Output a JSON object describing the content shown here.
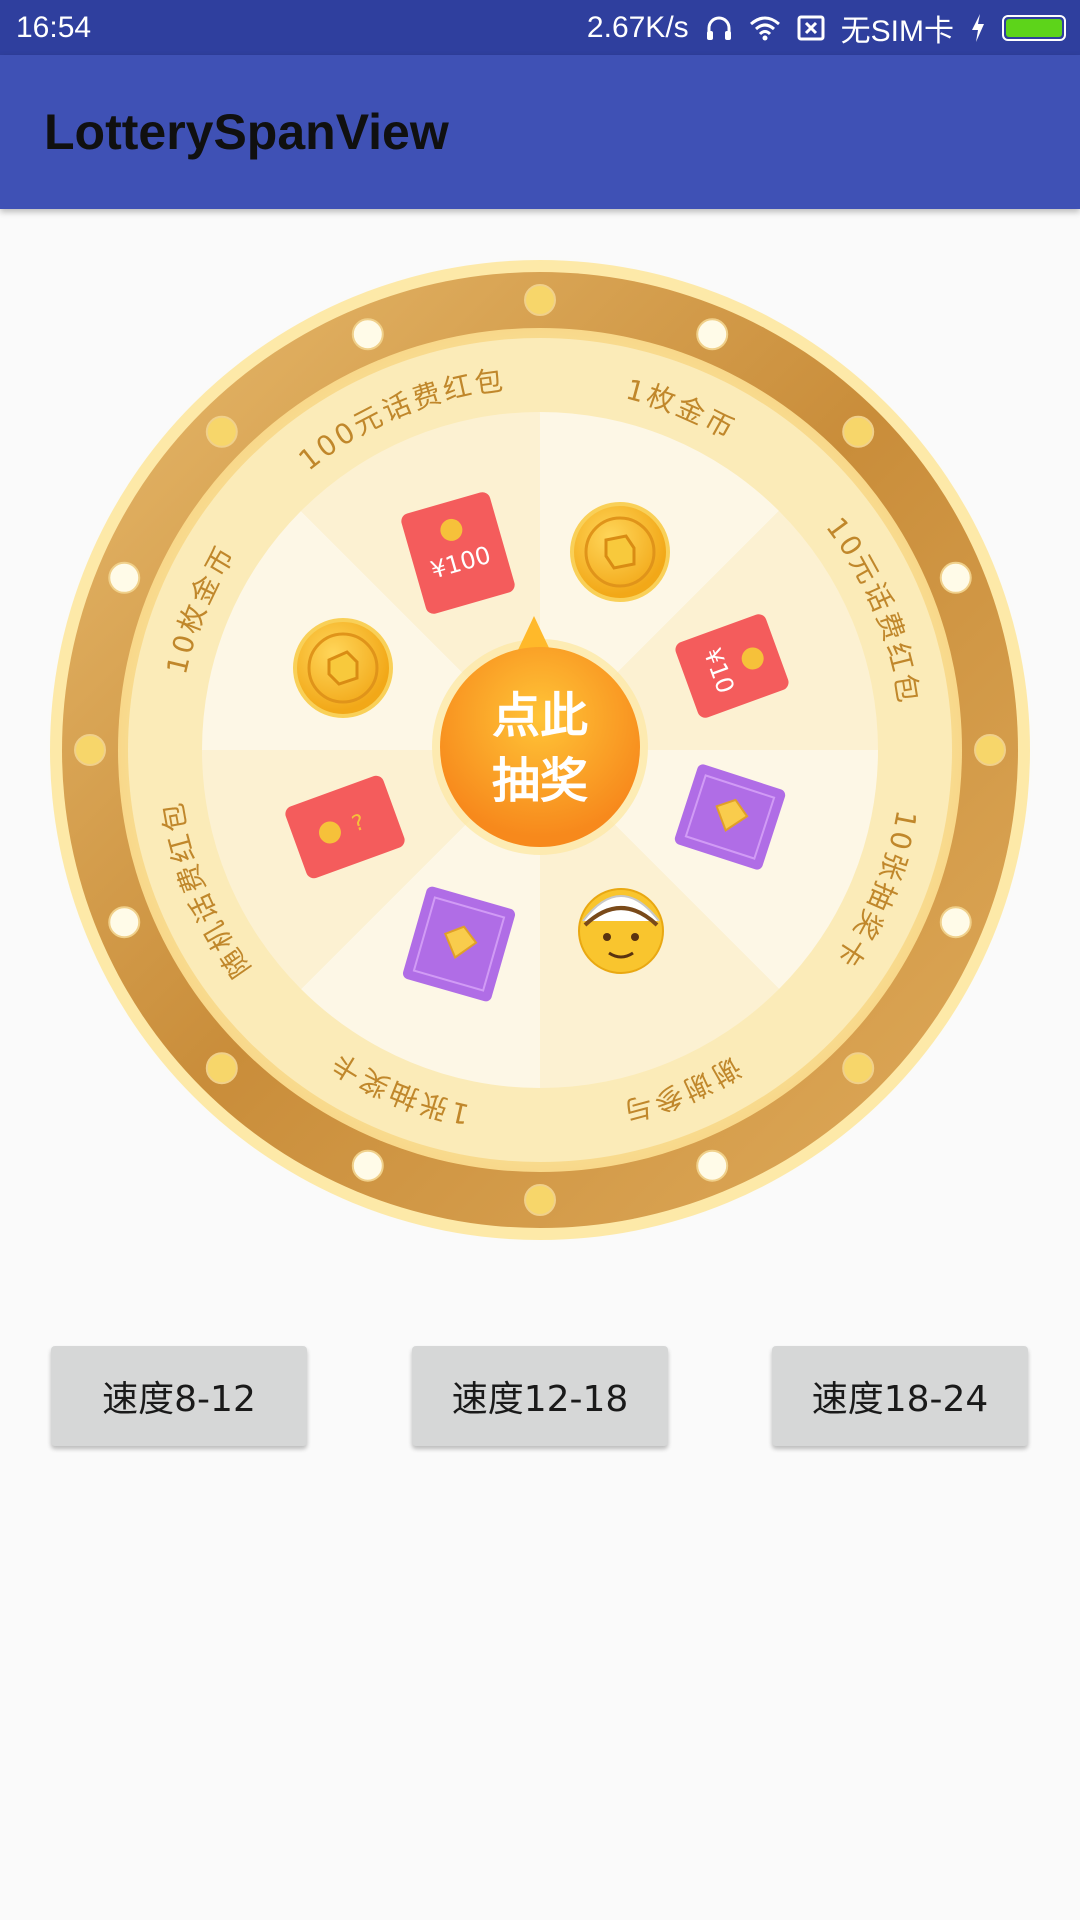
{
  "status_bar": {
    "time": "16:54",
    "speed": "2.67K/s",
    "sim": "无SIM卡",
    "icons": [
      "headset-icon",
      "wifi-icon",
      "no-sim-icon",
      "charging-icon",
      "battery-icon"
    ]
  },
  "app_bar": {
    "title": "LotterySpanView"
  },
  "wheel": {
    "center_label_line1": "点此",
    "center_label_line2": "抽奖",
    "prizes": [
      {
        "label": "1枚金币",
        "icon": "gold-coin-icon"
      },
      {
        "label": "10元话费红包",
        "icon": "red-envelope-10-icon"
      },
      {
        "label": "10张抽奖卡",
        "icon": "lottery-card-icon"
      },
      {
        "label": "谢谢参与",
        "icon": "emoji-icon"
      },
      {
        "label": "1张抽奖卡",
        "icon": "lottery-card-icon"
      },
      {
        "label": "随机话费红包",
        "icon": "red-envelope-random-icon"
      },
      {
        "label": "10枚金币",
        "icon": "gold-coin-icon"
      },
      {
        "label": "100元话费红包",
        "icon": "red-envelope-100-icon"
      }
    ],
    "envelope_100_text": "¥100",
    "envelope_10_text": "¥10",
    "envelope_random_text": "?",
    "colors": {
      "rim": "#d9a04e",
      "rim_light": "#fde8a8",
      "segment_a": "#fdf7e6",
      "segment_b": "#fcf1d2",
      "text": "#c0872b",
      "button": "#f79a1e"
    }
  },
  "buttons": [
    {
      "label": "速度8-12"
    },
    {
      "label": "速度12-18"
    },
    {
      "label": "速度18-24"
    }
  ]
}
